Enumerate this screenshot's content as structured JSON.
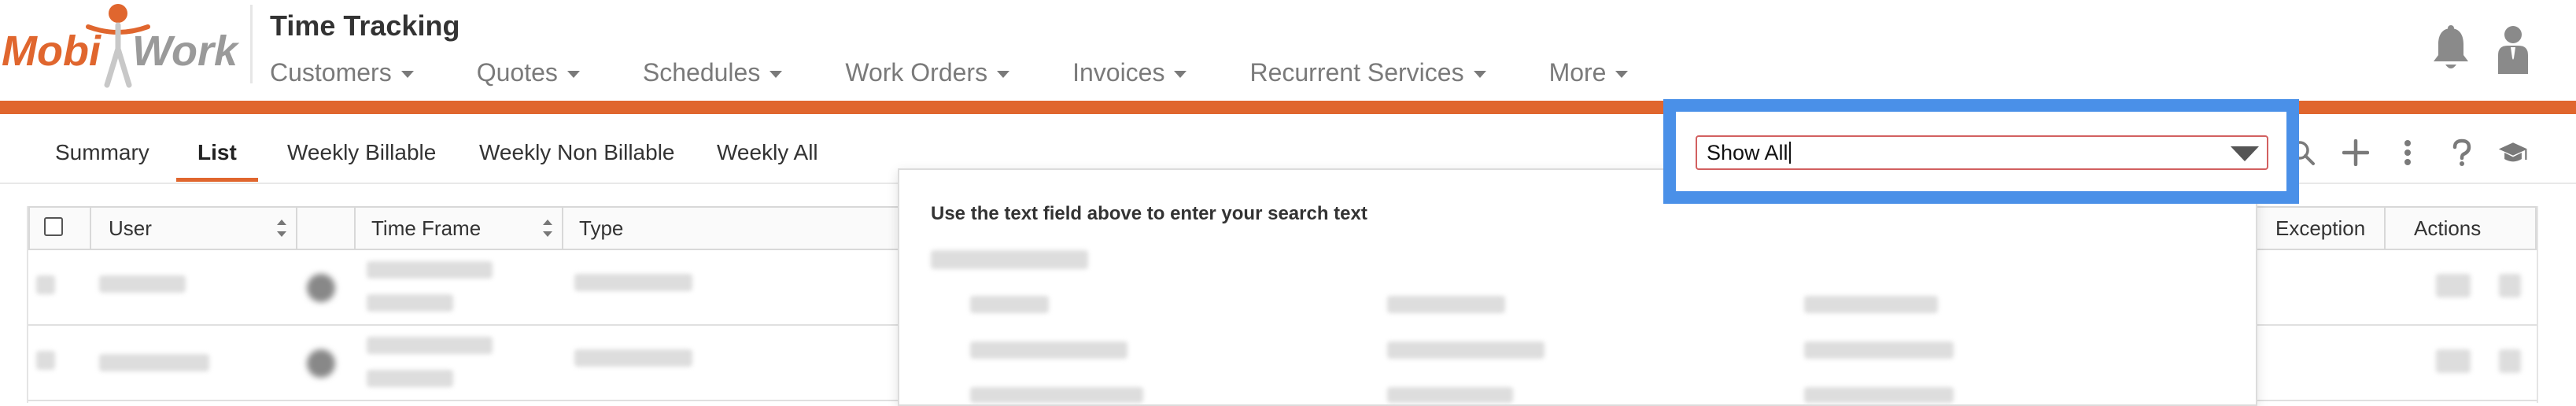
{
  "header": {
    "logo_text_left": "Mobi",
    "logo_text_right": "Work",
    "title": "Time Tracking",
    "nav": [
      {
        "label": "Customers"
      },
      {
        "label": "Quotes"
      },
      {
        "label": "Schedules"
      },
      {
        "label": "Work Orders"
      },
      {
        "label": "Invoices"
      },
      {
        "label": "Recurrent Services"
      },
      {
        "label": "More"
      }
    ],
    "icons": [
      "bell-icon",
      "user-icon"
    ]
  },
  "subtabs": [
    {
      "label": "Summary",
      "active": false
    },
    {
      "label": "List",
      "active": true
    },
    {
      "label": "Weekly Billable",
      "active": false
    },
    {
      "label": "Weekly Non Billable",
      "active": false
    },
    {
      "label": "Weekly All",
      "active": false
    }
  ],
  "toolbar": {
    "filter_value": "Show All",
    "icons": [
      "search-icon",
      "plus-icon",
      "more-vertical-icon",
      "help-icon",
      "graduation-cap-icon"
    ]
  },
  "search_panel": {
    "hint": "Use the text field above to enter your search text"
  },
  "table": {
    "columns": [
      "User",
      "Time Frame",
      "Type",
      "Exception",
      "Actions"
    ]
  },
  "colors": {
    "accent": "#e0662e",
    "highlight_border": "#4a90e8",
    "text": "#333333",
    "nav_text": "#7a7a7a"
  }
}
